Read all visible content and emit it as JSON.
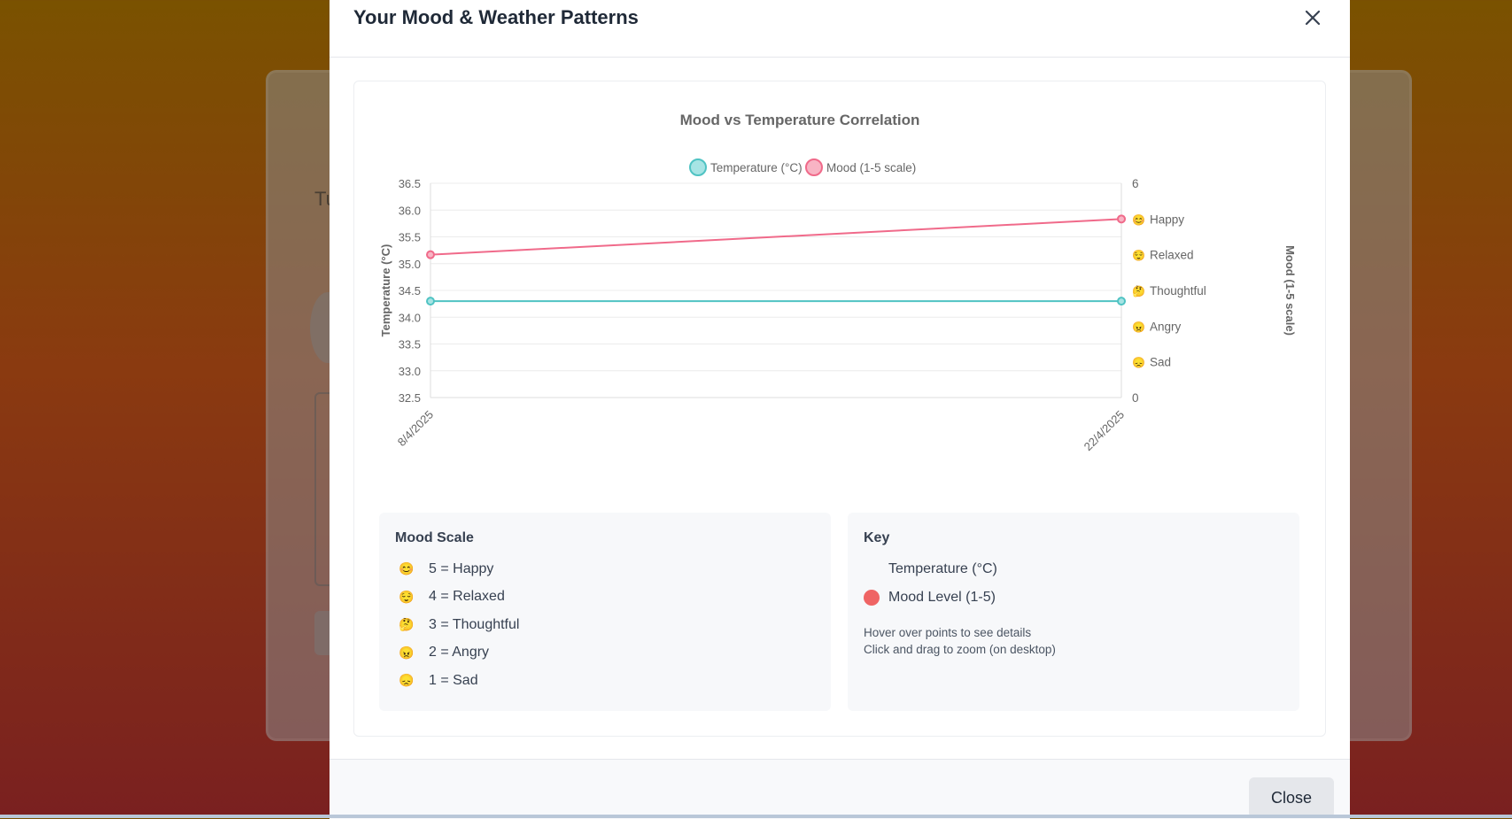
{
  "background": {
    "partial_text": "Tu"
  },
  "modal": {
    "title": "Your Mood & Weather Patterns",
    "close_icon": "close-icon",
    "footer_button": "Close"
  },
  "chart_data": {
    "type": "line",
    "title": "Mood vs Temperature Correlation",
    "x": [
      "8/4/2025",
      "22/4/2025"
    ],
    "series": [
      {
        "name": "Temperature (°C)",
        "axis": "left",
        "values": [
          34.3,
          34.3
        ],
        "color": "#4fc3c3"
      },
      {
        "name": "Mood (1-5 scale)",
        "axis": "right",
        "values": [
          4,
          5
        ],
        "color": "#f06a8a"
      }
    ],
    "y_left": {
      "label": "Temperature (°C)",
      "ylim": [
        32.5,
        36.5
      ],
      "ticks": [
        "36.5",
        "36.0",
        "35.5",
        "35.0",
        "34.5",
        "34.0",
        "33.5",
        "33.0",
        "32.5"
      ]
    },
    "y_right": {
      "label": "Mood (1-5 scale)",
      "ylim": [
        0,
        6
      ],
      "ticks": [
        {
          "v": 6,
          "label": "6",
          "emoji": ""
        },
        {
          "v": 5,
          "label": "Happy",
          "emoji": "😊"
        },
        {
          "v": 4,
          "label": "Relaxed",
          "emoji": "😌"
        },
        {
          "v": 3,
          "label": "Thoughtful",
          "emoji": "🤔"
        },
        {
          "v": 2,
          "label": "Angry",
          "emoji": "😠"
        },
        {
          "v": 1,
          "label": "Sad",
          "emoji": "😞"
        },
        {
          "v": 0,
          "label": "0",
          "emoji": ""
        }
      ]
    },
    "grid": true,
    "legend_position": "top"
  },
  "mood_scale": {
    "title": "Mood Scale",
    "items": [
      {
        "emoji": "😊",
        "text": "5 = Happy"
      },
      {
        "emoji": "😌",
        "text": "4 = Relaxed"
      },
      {
        "emoji": "🤔",
        "text": "3 = Thoughtful"
      },
      {
        "emoji": "😠",
        "text": "2 = Angry"
      },
      {
        "emoji": "😞",
        "text": "1 = Sad"
      }
    ]
  },
  "key": {
    "title": "Key",
    "items": [
      {
        "label": "Temperature (°C)"
      },
      {
        "label": "Mood Level (1-5)"
      }
    ],
    "note_line1": "Hover over points to see details",
    "note_line2": "Click and drag to zoom (on desktop)"
  },
  "colors": {
    "mood_dot": "#ef6464",
    "temp_line": "#4fc3c3",
    "mood_line": "#f06a8a"
  }
}
